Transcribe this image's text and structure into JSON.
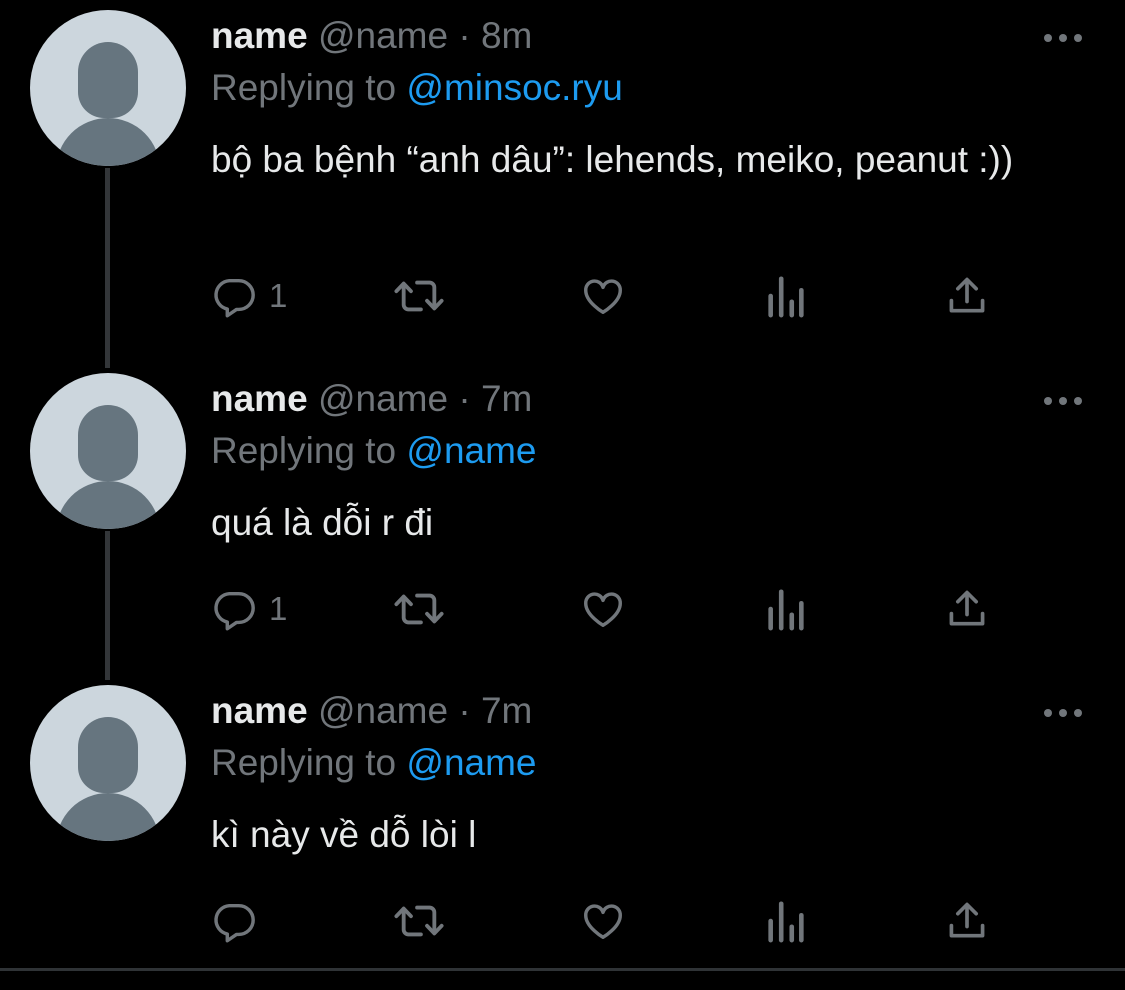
{
  "colors": {
    "background": "#000000",
    "text": "#e7e9ea",
    "muted": "#71767b",
    "accent": "#1d9bf0",
    "avatar_bg": "#ccd6dd",
    "avatar_fg": "#66757f"
  },
  "tweets": [
    {
      "display_name": "name",
      "handle": "@name",
      "separator": "·",
      "time": "8m",
      "replying_label": "Replying to",
      "replying_to": "@minsoc.ryu",
      "text": "bộ ba bệnh “anh dâu”: lehends, meiko, peanut :))",
      "reply_count": "1",
      "icons": [
        "reply-icon",
        "retweet-icon",
        "like-icon",
        "views-icon",
        "share-icon",
        "more-icon"
      ]
    },
    {
      "display_name": "name",
      "handle": "@name",
      "separator": "·",
      "time": "7m",
      "replying_label": "Replying to",
      "replying_to": "@name",
      "text": "quá là dỗi r đi",
      "reply_count": "1",
      "icons": [
        "reply-icon",
        "retweet-icon",
        "like-icon",
        "views-icon",
        "share-icon",
        "more-icon"
      ]
    },
    {
      "display_name": "name",
      "handle": "@name",
      "separator": "·",
      "time": "7m",
      "replying_label": "Replying to",
      "replying_to": "@name",
      "text": "kì này về dỗ lòi l",
      "reply_count": "",
      "icons": [
        "reply-icon",
        "retweet-icon",
        "like-icon",
        "views-icon",
        "share-icon",
        "more-icon"
      ]
    }
  ]
}
